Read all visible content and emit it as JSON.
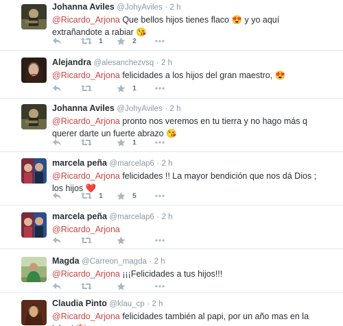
{
  "tweets": [
    {
      "name": "Johanna Aviles",
      "handle": "@JohyAviles",
      "sep": "·",
      "time": "2 h",
      "mention": "@Ricardo_Arjona",
      "text": " Que bellos hijos tienes flaco 😍 y yo aquí extrañandote a rabiar 😘",
      "retweets": "1",
      "favorites": "2",
      "avatar_colors": [
        "#3a3a2a",
        "#6b6a48"
      ]
    },
    {
      "name": "Alejandra",
      "handle": "@alesanchezvsq",
      "sep": "·",
      "time": "2 h",
      "mention": "@Ricardo_Arjona",
      "text": " felicidades a los hijos del gran maestro, 😍",
      "retweets": "",
      "favorites": "1",
      "avatar_colors": [
        "#2b1d16",
        "#c9a48d"
      ]
    },
    {
      "name": "Johanna Aviles",
      "handle": "@JohyAviles",
      "sep": "·",
      "time": "2 h",
      "mention": "@Ricardo_Arjona",
      "text": " pronto nos veremos en tu tierra y no hago más q querer darte un fuerte abrazo 😘",
      "retweets": "",
      "favorites": "1",
      "avatar_colors": [
        "#3a3a2a",
        "#6b6a48"
      ]
    },
    {
      "name": "marcela peña",
      "handle": "@marcelap6",
      "sep": "·",
      "time": "2 h",
      "mention": "@Ricardo_Arjona",
      "text": " felicidades !! La mayor bendición  que nos dá Dios ; los hijos ❤️",
      "retweets": "1",
      "favorites": "5",
      "avatar_colors": [
        "#5a3340",
        "#2a4f8a"
      ]
    },
    {
      "name": "marcela peña",
      "handle": "@marcelap6",
      "sep": "·",
      "time": "2 h",
      "mention": "@Ricardo_Arjona",
      "text": "",
      "retweets": "",
      "favorites": "",
      "avatar_colors": [
        "#5a3340",
        "#2a4f8a"
      ]
    },
    {
      "name": "Magda",
      "handle": "@Carreon_magda",
      "sep": "·",
      "time": "2 h",
      "mention": "@Ricardo_Arjona",
      "text": " ¡¡¡Felicidades a tus hijos!!!",
      "retweets": "",
      "favorites": "",
      "avatar_colors": [
        "#4f7a3a",
        "#9bb27a"
      ]
    },
    {
      "name": "Claudia Pinto",
      "handle": "@klau_cp",
      "sep": "·",
      "time": "2 h",
      "mention": "@Ricardo_Arjona",
      "text": " felicidades también al papi, por un año mas en la labor! 🎉",
      "retweets": "",
      "favorites": "",
      "avatar_colors": [
        "#5a2a1a",
        "#c79a6a"
      ]
    }
  ]
}
